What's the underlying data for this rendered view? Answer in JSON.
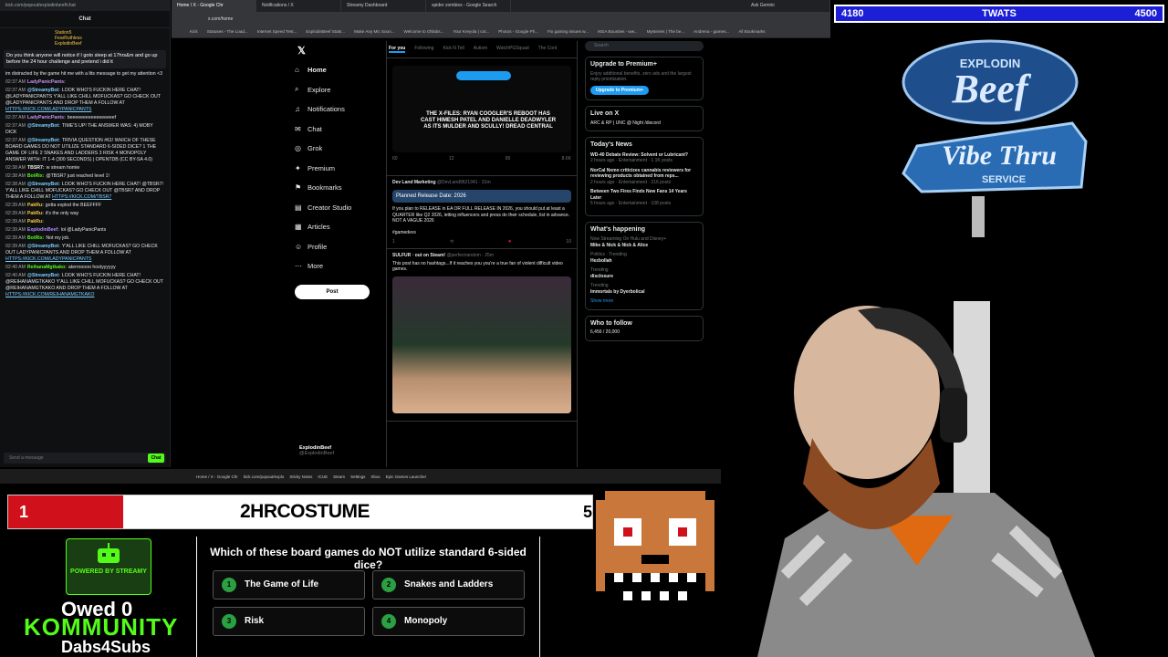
{
  "chat": {
    "url": "kick.com/popout/explodinbeef/chat",
    "title": "Chat",
    "top_users": [
      "Station5",
      "FearRuthless",
      "ExplodinBeef"
    ],
    "pinned": "Do you think anyone will notice if I goto sleep at 17hrs&m and go up before the 24 hour challenge and pretend i did it",
    "pinned_tail": "im distracted by the game hit me with a ltts message to get my attention <3",
    "messages": [
      {
        "ts": "02:37 AM",
        "user": "LadyPanicPants:",
        "text": "",
        "color": "#c792ea"
      },
      {
        "ts": "02:37 AM",
        "user": "@StreamyBot:",
        "text": "LOOK WHO'S FUCKIN HERE CHAT! @LADYPANICPANTS Y'ALL LIKE CHILL MOFUCKAS? GO CHECK OUT @LADYPANICPANTS AND DROP THEM A FOLLOW AT",
        "link": "HTTPS://KICK.COM/LADYPANICPANTS",
        "color": "#7fd0ff"
      },
      {
        "ts": "02:37 AM",
        "user": "LadyPanicPants:",
        "text": "beeeeeeeeeeeeeeeeef",
        "color": "#c792ea"
      },
      {
        "ts": "02:37 AM",
        "user": "@StreamyBot:",
        "text": "TIME'S UP! THE ANSWER WAS: 4) MOBY DICK",
        "color": "#7fd0ff"
      },
      {
        "ts": "02:37 AM",
        "user": "@StreamyBot:",
        "text": "TRIVIA QUESTION #61! WHICH OF THESE BOARD GAMES DO NOT UTILIZE STANDARD 6-SIDED DICE? 1 THE GAME OF LIFE 2 SNAKES AND LADDERS 3 RISK 4 MONOPOLY ANSWER WITH: IT 1-4 (300 SECONDS) | OPENTDB (CC BY-SA 4.0)",
        "color": "#7fd0ff"
      },
      {
        "ts": "02:38 AM",
        "user": "TBSR7:",
        "text": "w stream homie",
        "color": "#f0f0f0"
      },
      {
        "ts": "02:38 AM",
        "user": "BotRix:",
        "text": "@TBSR7 just reached level 1!",
        "color": "#53fc18"
      },
      {
        "ts": "02:38 AM",
        "user": "@StreamyBot:",
        "text": "LOOK WHO'S FUCKIN HERE CHAT! @TBSR7! Y'ALL LIKE CHILL MOFUCKAS? GO CHECK OUT @TBSR7 AND DROP THEM A FOLLOW AT",
        "link": "HTTPS://KICK.COM/TBSR7",
        "color": "#7fd0ff"
      },
      {
        "ts": "02:39 AM",
        "user": "PakRu:",
        "text": "gotta explod the BEEFFFF",
        "color": "#f7c948"
      },
      {
        "ts": "02:39 AM",
        "user": "PakRu:",
        "text": "it's the only way",
        "color": "#f7c948"
      },
      {
        "ts": "02:39 AM",
        "user": "PakRu:",
        "text": "",
        "color": "#f7c948"
      },
      {
        "ts": "02:39 AM",
        "user": "ExplodinBeef:",
        "text": "lol @LadyPanicPants",
        "color": "#b48cff"
      },
      {
        "ts": "02:39 AM",
        "user": "BotRix:",
        "text": "Not my job.",
        "color": "#53fc18"
      },
      {
        "ts": "02:39 AM",
        "user": "@StreamyBot:",
        "text": "Y'ALL LIKE CHILL MOFUCKAS? GO CHECK OUT LADYPANICPANTS AND DROP THEM A FOLLOW AT",
        "link": "HTTPS://KICK.COM/LADYPANICPANTS",
        "color": "#7fd0ff"
      },
      {
        "ts": "02:40 AM",
        "user": "ReihanaMgtkako:",
        "text": "aterrooooo hostyyyyyy",
        "color": "#53fc18"
      },
      {
        "ts": "02:40 AM",
        "user": "@StreamyBot:",
        "text": "LOOK WHO'S FUCKIN HERE CHAT! @REIHANAMGTKAKO Y'ALL LIKE CHILL MOFUCKAS? GO CHECK OUT @REIHANAMGTKAKO AND DROP THEM A FOLLOW AT",
        "link": "HTTPS://KICK.COM/REIHANAMGTKAKO",
        "color": "#7fd0ff"
      }
    ],
    "input_placeholder": "Send a message",
    "send_label": "Chat"
  },
  "browser": {
    "tabs": [
      "Home / X - Google Chr",
      "Notifications / X",
      "Streamy Dashboard",
      "spider zombies - Google Search",
      "Ask Gemini"
    ],
    "url": "x.com/home",
    "bookmarks": [
      "Kick",
      "Statuses - The Load...",
      "Internet Speed Test...",
      "ExplodinBeef Stats...",
      "Make Any Mic Soun...",
      "Welcome to Ohlabs...",
      "Your Kreyola | cot...",
      "Photos - Google Ph...",
      "Fix gaming issues w...",
      "IKEA Bounties - ww...",
      "Mysteries | The be...",
      "Andrena - games...",
      "All Bookmarks"
    ]
  },
  "x": {
    "nav": [
      "Home",
      "Explore",
      "Notifications",
      "Chat",
      "Grok",
      "Premium",
      "Bookmarks",
      "Creator Studio",
      "Articles",
      "Profile",
      "More"
    ],
    "nav_icons": [
      "home-icon",
      "search-icon",
      "bell-icon",
      "chat-icon",
      "grok-icon",
      "premium-icon",
      "bookmark-icon",
      "creator-icon",
      "article-icon",
      "profile-icon",
      "more-icon"
    ],
    "post_button": "Post",
    "account_name": "ExplodinBeef",
    "account_handle": "@ExplodinBeef",
    "feed_tabs": [
      "For you",
      "Following",
      "Kick N Tell",
      "Autism",
      "WatchPGSquad",
      "The Cont"
    ],
    "posts": [
      {
        "name": "",
        "handle": "",
        "body": "THE X-FILES: RYAN COOGLER'S REBOOT HAS CAST HIMESH PATEL AND DANIELLE DEADWYLER AS ITS MULDER AND SCULLY! DREAD CENTRAL",
        "stats": [
          "60",
          "12",
          "65",
          "8.6K"
        ]
      },
      {
        "name": "Dev Land Marketing",
        "handle": "@DevLand9621341 · 31m",
        "body": "Planned Release Date: 2026",
        "quote": "If you plan to RELEASE in EA OR FULL RELEASE IN 2026, you should put at least a QUARTER like Q2 2026, letting influencers and press do their schedule, list in advance. NOT A VAGUE 2026",
        "tag": "#gamedevs",
        "stats": [
          "1",
          "",
          "",
          "10"
        ]
      },
      {
        "name": "SULFUR · out on Steam!",
        "handle": "@perfectrandom · 25m",
        "body": "This post has no hashtags...If it reaches you you're a true fan of violent difficult video games.",
        "stats": []
      }
    ]
  },
  "sidebar": {
    "search_placeholder": "Search",
    "premium_title": "Upgrade to Premium+",
    "premium_text": "Enjoy additional benefits, zero ads and the largest reply prioritization.",
    "premium_button": "Upgrade to Premium+",
    "live_title": "Live on X",
    "live_item": "ARC & RP | UNC @ Night /discord",
    "news_title": "Today's News",
    "news": [
      {
        "title": "WD-40 Debate Review: Solvent or Lubricant?",
        "meta": "2 hours ago · Entertainment · 1.1K posts"
      },
      {
        "title": "NorCal Nemo criticizes cannabis reviewers for reviewing products obtained from reps...",
        "meta": "2 hours ago · Entertainment · 216 posts"
      },
      {
        "title": "Between Two Fires Finds New Fans 14 Years Later",
        "meta": "5 hours ago · Entertainment · 108 posts"
      }
    ],
    "happening_title": "What's happening",
    "happening": [
      {
        "title": "Mike & Nick & Nick & Alice",
        "meta": "Now Streaming On Hulu and Disney+"
      },
      {
        "title": "Hezbollah",
        "meta": "Politics · Trending"
      },
      {
        "title": "disclosure",
        "meta": "Trending"
      },
      {
        "title": "Immortals by Dyerbolical",
        "meta": "Trending"
      }
    ],
    "show_more": "Show more",
    "follow_title": "Who to follow",
    "follow_progress": "6,456 / 20,000"
  },
  "taskbar": {
    "items": [
      "Home / X - Google Chr",
      "kick.com/popout/explo",
      "Sticky Notes",
      "ICUE",
      "Steam",
      "Settings",
      "Xbox",
      "Epic Games Launcher"
    ]
  },
  "goal": {
    "left": "4180",
    "label": "TWATS",
    "right": "4500"
  },
  "logo": {
    "line1": "EXPLODIN",
    "line2": "Beef",
    "line3": "Vibe Thru",
    "line4": "SERVICE"
  },
  "trivia": {
    "rank": "1",
    "leader_name": "2HRCOSTUME",
    "leader_score": "5",
    "question": "Which of these board games do NOT utilize standard 6-sided dice?",
    "options": [
      {
        "num": "1",
        "text": "The Game of Life"
      },
      {
        "num": "2",
        "text": "Snakes and Ladders"
      },
      {
        "num": "3",
        "text": "Risk"
      },
      {
        "num": "4",
        "text": "Monopoly"
      }
    ]
  },
  "streamy": {
    "label": "POWERED BY STREAMY"
  },
  "community": {
    "owed": "Owed 0",
    "kommunity": "KOMMUNITY",
    "dabs": "Dabs4Subs"
  }
}
